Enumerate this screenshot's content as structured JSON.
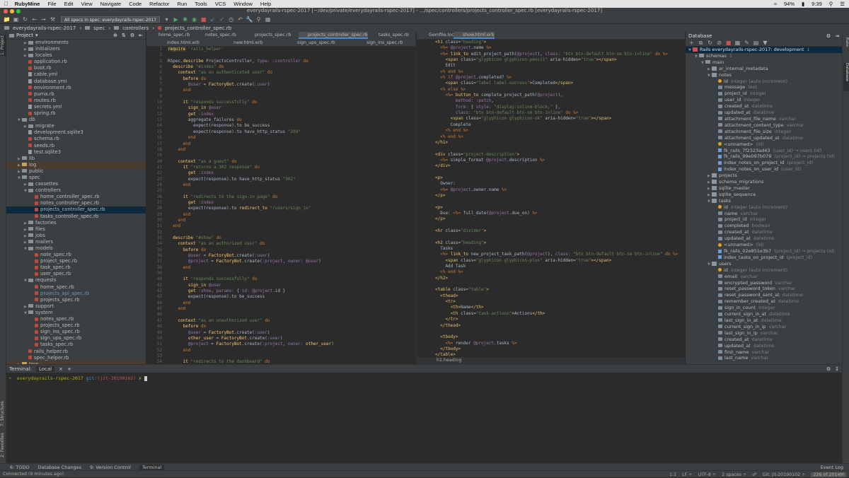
{
  "menubar": {
    "app_name": "RubyMine",
    "items": [
      "File",
      "Edit",
      "View",
      "Navigate",
      "Code",
      "Refactor",
      "Run",
      "Tools",
      "VCS",
      "Window",
      "Help"
    ],
    "battery": "94%",
    "time": "9:39"
  },
  "window_title": "everydayrails-rspec-2017 [~/dev/private/everydayrails-rspec-2017] - .../spec/controllers/projects_controller_spec.rb [everydayrails-rspec-2017]",
  "toolbar": {
    "run_config": "All specs in spec: everydayrails-rspec-2017"
  },
  "breadcrumb": [
    "everydayrails-rspec-2017",
    "spec",
    "controllers",
    "projects_controller_spec.rb"
  ],
  "project_panel": {
    "title": "Project",
    "tree": [
      {
        "d": 1,
        "t": "f",
        "n": "environments"
      },
      {
        "d": 1,
        "t": "f",
        "n": "initializers"
      },
      {
        "d": 1,
        "t": "f",
        "n": "locales"
      },
      {
        "d": 1,
        "t": "r",
        "n": "application.rb"
      },
      {
        "d": 1,
        "t": "r",
        "n": "boot.rb"
      },
      {
        "d": 1,
        "t": "o",
        "n": "cable.yml"
      },
      {
        "d": 1,
        "t": "o",
        "n": "database.yml"
      },
      {
        "d": 1,
        "t": "r",
        "n": "environment.rb"
      },
      {
        "d": 1,
        "t": "r",
        "n": "puma.rb"
      },
      {
        "d": 1,
        "t": "r",
        "n": "routes.rb"
      },
      {
        "d": 1,
        "t": "o",
        "n": "secrets.yml"
      },
      {
        "d": 1,
        "t": "r",
        "n": "spring.rb"
      },
      {
        "d": 0,
        "t": "f",
        "n": "db",
        "open": true
      },
      {
        "d": 1,
        "t": "f",
        "n": "migrate"
      },
      {
        "d": 1,
        "t": "o",
        "n": "development.sqlite3"
      },
      {
        "d": 1,
        "t": "r",
        "n": "schema.rb"
      },
      {
        "d": 1,
        "t": "r",
        "n": "seeds.rb"
      },
      {
        "d": 1,
        "t": "o",
        "n": "test.sqlite3"
      },
      {
        "d": 0,
        "t": "f",
        "n": "lib"
      },
      {
        "d": 0,
        "t": "f",
        "n": "log",
        "hl": true
      },
      {
        "d": 0,
        "t": "f",
        "n": "public"
      },
      {
        "d": 0,
        "t": "f",
        "n": "spec",
        "open": true
      },
      {
        "d": 1,
        "t": "f",
        "n": "cassettes"
      },
      {
        "d": 1,
        "t": "f",
        "n": "controllers",
        "open": true
      },
      {
        "d": 2,
        "t": "r",
        "n": "home_controller_spec.rb"
      },
      {
        "d": 2,
        "t": "r",
        "n": "notes_controller_spec.rb"
      },
      {
        "d": 2,
        "t": "r",
        "n": "projects_controller_spec.rb",
        "sel": true
      },
      {
        "d": 2,
        "t": "r",
        "n": "tasks_controller_spec.rb"
      },
      {
        "d": 1,
        "t": "f",
        "n": "factories"
      },
      {
        "d": 1,
        "t": "f",
        "n": "files"
      },
      {
        "d": 1,
        "t": "f",
        "n": "jobs"
      },
      {
        "d": 1,
        "t": "f",
        "n": "mailers"
      },
      {
        "d": 1,
        "t": "f",
        "n": "models",
        "open": true
      },
      {
        "d": 2,
        "t": "r",
        "n": "note_spec.rb"
      },
      {
        "d": 2,
        "t": "r",
        "n": "project_spec.rb"
      },
      {
        "d": 2,
        "t": "r",
        "n": "task_spec.rb"
      },
      {
        "d": 2,
        "t": "r",
        "n": "user_spec.rb"
      },
      {
        "d": 1,
        "t": "f",
        "n": "requests",
        "open": true
      },
      {
        "d": 2,
        "t": "r",
        "n": "home_spec.rb"
      },
      {
        "d": 2,
        "t": "r",
        "n": "projects_api_spec.rb",
        "blue": true
      },
      {
        "d": 2,
        "t": "r",
        "n": "projects_spec.rb"
      },
      {
        "d": 1,
        "t": "f",
        "n": "support"
      },
      {
        "d": 1,
        "t": "f",
        "n": "system",
        "open": true
      },
      {
        "d": 2,
        "t": "r",
        "n": "notes_spec.rb"
      },
      {
        "d": 2,
        "t": "r",
        "n": "projects_spec.rb"
      },
      {
        "d": 2,
        "t": "r",
        "n": "sign_ins_spec.rb"
      },
      {
        "d": 2,
        "t": "r",
        "n": "sign_ups_spec.rb"
      },
      {
        "d": 2,
        "t": "r",
        "n": "tasks_spec.rb"
      },
      {
        "d": 1,
        "t": "r",
        "n": "rails_helper.rb"
      },
      {
        "d": 1,
        "t": "r",
        "n": "spec_helper.rb"
      },
      {
        "d": 0,
        "t": "f",
        "n": "tmp",
        "hl": true
      }
    ]
  },
  "editor_left": {
    "tabs_row1": [
      "home_spec.rb",
      "notes_spec.rb",
      "projects_spec.rb",
      "projects_controller_spec.rb",
      "tasks_spec.rb"
    ],
    "tabs_row2": [
      "index.html.erb",
      "new.html.erb",
      "sign_ups_spec.rb",
      "sign_ins_spec.rb"
    ]
  },
  "editor_right": {
    "tabs": [
      "Gemfile.lock",
      "show.html.erb"
    ],
    "breadcrumb": "h1.heading"
  },
  "database_panel": {
    "title": "Database",
    "tree": [
      {
        "d": 0,
        "k": "db",
        "n": "Rails everydayrails-rspec-2017: development",
        "g": "1",
        "sel": true
      },
      {
        "d": 1,
        "k": "f",
        "n": "schemas",
        "g": "1"
      },
      {
        "d": 2,
        "k": "f",
        "n": "main"
      },
      {
        "d": 3,
        "k": "t",
        "n": "ar_internal_metadata"
      },
      {
        "d": 3,
        "k": "t",
        "n": "notes"
      },
      {
        "d": 4,
        "k": "key",
        "n": "id",
        "g": "integer (auto increment)"
      },
      {
        "d": 4,
        "k": "c",
        "n": "message",
        "g": "text"
      },
      {
        "d": 4,
        "k": "c",
        "n": "project_id",
        "g": "integer"
      },
      {
        "d": 4,
        "k": "c",
        "n": "user_id",
        "g": "integer"
      },
      {
        "d": 4,
        "k": "c",
        "n": "created_at",
        "g": "datetime"
      },
      {
        "d": 4,
        "k": "c",
        "n": "updated_at",
        "g": "datetime"
      },
      {
        "d": 4,
        "k": "c",
        "n": "attachment_file_name",
        "g": "varchar"
      },
      {
        "d": 4,
        "k": "c",
        "n": "attachment_content_type",
        "g": "varchar"
      },
      {
        "d": 4,
        "k": "c",
        "n": "attachment_file_size",
        "g": "integer"
      },
      {
        "d": 4,
        "k": "c",
        "n": "attachment_updated_at",
        "g": "datetime"
      },
      {
        "d": 4,
        "k": "key",
        "n": "<unnamed>",
        "g": "(id)"
      },
      {
        "d": 4,
        "k": "i",
        "n": "fk_rails_7f2323ad43",
        "g": "(user_id) → users (id)"
      },
      {
        "d": 4,
        "k": "i",
        "n": "fk_rails_99e097b079",
        "g": "(project_id) → projects (id)"
      },
      {
        "d": 4,
        "k": "i",
        "n": "index_notes_on_project_id",
        "g": "(project_id)"
      },
      {
        "d": 4,
        "k": "i",
        "n": "index_notes_on_user_id",
        "g": "(user_id)"
      },
      {
        "d": 3,
        "k": "t",
        "n": "projects"
      },
      {
        "d": 3,
        "k": "t",
        "n": "schema_migrations"
      },
      {
        "d": 3,
        "k": "t",
        "n": "sqlite_master"
      },
      {
        "d": 3,
        "k": "t",
        "n": "sqlite_sequence"
      },
      {
        "d": 3,
        "k": "t",
        "n": "tasks"
      },
      {
        "d": 4,
        "k": "key",
        "n": "id",
        "g": "integer (auto increment)"
      },
      {
        "d": 4,
        "k": "c",
        "n": "name",
        "g": "varchar"
      },
      {
        "d": 4,
        "k": "c",
        "n": "project_id",
        "g": "integer"
      },
      {
        "d": 4,
        "k": "c",
        "n": "completed",
        "g": "boolean"
      },
      {
        "d": 4,
        "k": "c",
        "n": "created_at",
        "g": "datetime"
      },
      {
        "d": 4,
        "k": "c",
        "n": "updated_at",
        "g": "datetime"
      },
      {
        "d": 4,
        "k": "key",
        "n": "<unnamed>",
        "g": "(id)"
      },
      {
        "d": 4,
        "k": "i",
        "n": "fk_rails_02e851e3b7",
        "g": "(project_id) → projects (id)"
      },
      {
        "d": 4,
        "k": "i",
        "n": "index_tasks_on_project_id",
        "g": "(project_id)"
      },
      {
        "d": 3,
        "k": "t",
        "n": "users"
      },
      {
        "d": 4,
        "k": "key",
        "n": "id",
        "g": "integer (auto increment)"
      },
      {
        "d": 4,
        "k": "c",
        "n": "email",
        "g": "varchar"
      },
      {
        "d": 4,
        "k": "c",
        "n": "encrypted_password",
        "g": "varchar"
      },
      {
        "d": 4,
        "k": "c",
        "n": "reset_password_token",
        "g": "varchar"
      },
      {
        "d": 4,
        "k": "c",
        "n": "reset_password_sent_at",
        "g": "datetime"
      },
      {
        "d": 4,
        "k": "c",
        "n": "remember_created_at",
        "g": "datetime"
      },
      {
        "d": 4,
        "k": "c",
        "n": "sign_in_count",
        "g": "integer"
      },
      {
        "d": 4,
        "k": "c",
        "n": "current_sign_in_at",
        "g": "datetime"
      },
      {
        "d": 4,
        "k": "c",
        "n": "last_sign_in_at",
        "g": "datetime"
      },
      {
        "d": 4,
        "k": "c",
        "n": "current_sign_in_ip",
        "g": "varchar"
      },
      {
        "d": 4,
        "k": "c",
        "n": "last_sign_in_ip",
        "g": "varchar"
      },
      {
        "d": 4,
        "k": "c",
        "n": "created_at",
        "g": "datetime"
      },
      {
        "d": 4,
        "k": "c",
        "n": "updated_at",
        "g": "datetime"
      },
      {
        "d": 4,
        "k": "c",
        "n": "first_name",
        "g": "varchar"
      },
      {
        "d": 4,
        "k": "c",
        "n": "last_name",
        "g": "varchar"
      }
    ]
  },
  "terminal": {
    "label": "Terminal:",
    "tab": "Local",
    "prompt_dir": "everydayrails-rspec-2017",
    "git_label": "git:",
    "branch": "(jit-20190102)",
    "prompt_symbol": "✗"
  },
  "bottom_tabs": [
    "6: TODO",
    "Database Changes",
    "9: Version Control",
    "Terminal"
  ],
  "status": {
    "left": "Connected (9 minutes ago)",
    "position": "1:1",
    "line_sep": "LF ÷",
    "encoding": "UTF-8 ÷",
    "indent": "2 spaces ÷",
    "git": "Git: jit-20190102 ÷",
    "memory": "226 of 2014M",
    "event_log": "Event Log"
  },
  "side_tabs": {
    "left": [
      "1: Project",
      "7: Structure",
      "2: Favorites"
    ],
    "right": [
      "Rake",
      "Database"
    ]
  }
}
